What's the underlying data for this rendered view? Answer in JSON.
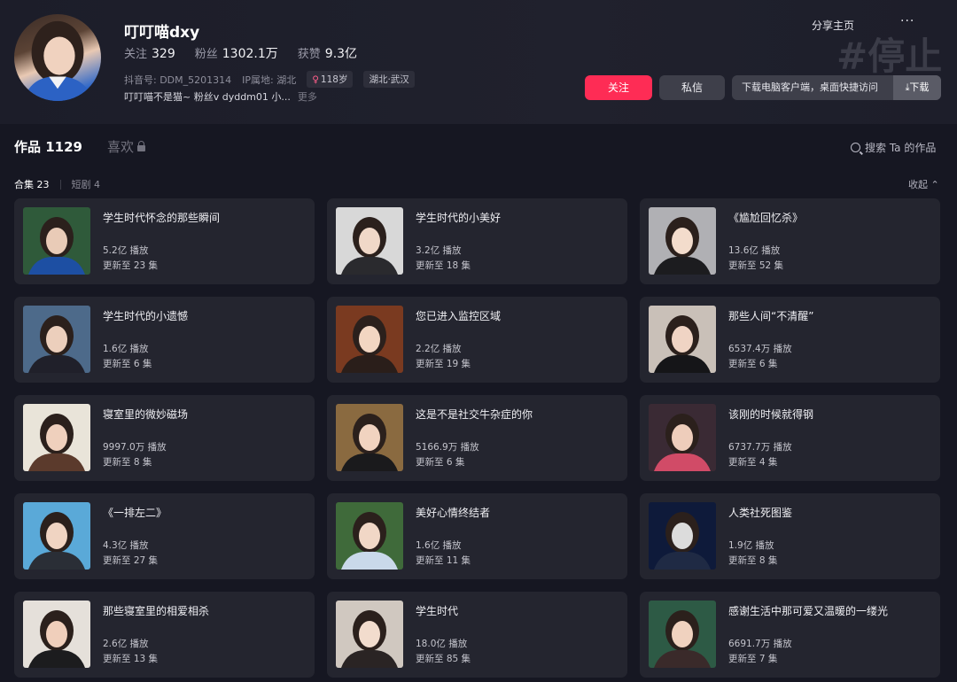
{
  "profile": {
    "nickname": "叮叮喵dxy",
    "follow_label": "关注",
    "follow_count": "329",
    "fans_label": "粉丝",
    "fans_count": "1302.1万",
    "likes_label": "获赞",
    "likes_count": "9.3亿",
    "douyin_id": "抖音号: DDM_5201314",
    "ip": "IP属地: 湖北",
    "age_tag": "118岁",
    "location_tag": "湖北·武汉",
    "bio": "叮叮喵不是猫~ 粉丝v dyddm01 小...",
    "bio_more": "更多"
  },
  "header": {
    "share_label": "分享主页",
    "more_label": "···",
    "watermark": "#停止",
    "follow_button": "关注",
    "message_button": "私信",
    "download_text": "下载电脑客户端，桌面快捷访问",
    "download_button": "⤓下载"
  },
  "tabs": {
    "works_label": "作品 1129",
    "likes_label": "喜欢",
    "search_label": "搜索 Ta 的作品"
  },
  "subtabs": {
    "collections": "合集 23",
    "dramas": "短剧 4",
    "collapse": "收起 ⌃"
  },
  "colors": {
    "accent": "#fe2c55",
    "background": "#161722",
    "card": "#24252f"
  },
  "collections": [
    {
      "title": "学生时代怀念的那些瞬间",
      "plays": "5.2亿 播放",
      "updated": "更新至 23 集"
    },
    {
      "title": "学生时代的小美好",
      "plays": "3.2亿 播放",
      "updated": "更新至 18 集"
    },
    {
      "title": "《尴尬回忆杀》",
      "plays": "13.6亿 播放",
      "updated": "更新至 52 集"
    },
    {
      "title": "学生时代的小遗憾",
      "plays": "1.6亿 播放",
      "updated": "更新至 6 集"
    },
    {
      "title": "您已进入监控区域",
      "plays": "2.2亿 播放",
      "updated": "更新至 19 集"
    },
    {
      "title": "那些人间“不清醒”",
      "plays": "6537.4万 播放",
      "updated": "更新至 6 集"
    },
    {
      "title": "寝室里的微妙磁场",
      "plays": "9997.0万 播放",
      "updated": "更新至 8 集"
    },
    {
      "title": "这是不是社交牛杂症的你",
      "plays": "5166.9万 播放",
      "updated": "更新至 6 集"
    },
    {
      "title": "该刚的时候就得钢",
      "plays": "6737.7万 播放",
      "updated": "更新至 4 集"
    },
    {
      "title": "《一排左二》",
      "plays": "4.3亿 播放",
      "updated": "更新至 27 集"
    },
    {
      "title": "美好心情终结者",
      "plays": "1.6亿 播放",
      "updated": "更新至 11 集"
    },
    {
      "title": "人类社死图鉴",
      "plays": "1.9亿 播放",
      "updated": "更新至 8 集"
    },
    {
      "title": "那些寝室里的相爱相杀",
      "plays": "2.6亿 播放",
      "updated": "更新至 13 集"
    },
    {
      "title": "学生时代",
      "plays": "18.0亿 播放",
      "updated": "更新至 85 集"
    },
    {
      "title": "感谢生活中那可爱又温暖的一缕光",
      "plays": "6691.7万 播放",
      "updated": "更新至 7 集"
    }
  ]
}
